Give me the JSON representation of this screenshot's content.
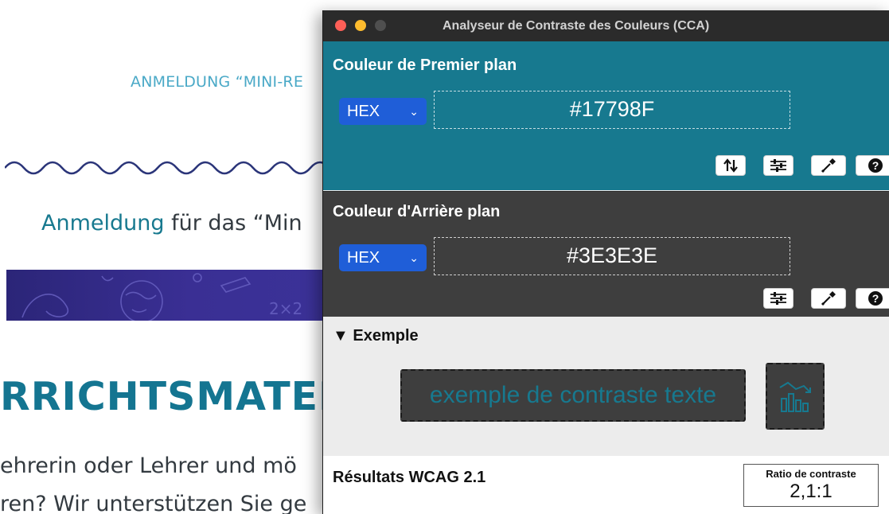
{
  "site": {
    "subtitle": "ANMELDUNG “MINI-RE",
    "lead_link": "Anmeldung",
    "lead_rest": " für das “Min",
    "heading": "RRICHTSMATERIA",
    "para1": "ehrerin oder Lehrer und mö",
    "para2": "ren? Wir unterstützen Sie ge",
    "banner_text": "2×2",
    "colors": {
      "accent": "#17798f",
      "subtitle": "#4aa9c7",
      "banner": "#2b2578"
    }
  },
  "window": {
    "title": "Analyseur de Contraste des Couleurs (CCA)"
  },
  "foreground": {
    "title": "Couleur de Premier plan",
    "format": "HEX",
    "value": "#17798F",
    "tools": [
      "swap-icon",
      "sliders-icon",
      "eyedropper-icon",
      "help-icon"
    ]
  },
  "background": {
    "title": "Couleur d'Arrière plan",
    "format": "HEX",
    "value": "#3E3E3E",
    "tools": [
      "sliders-icon",
      "eyedropper-icon",
      "help-icon"
    ]
  },
  "example": {
    "heading": "▼ Exemple",
    "sample_text": "exemple de contraste texte",
    "chart_button_icon": "chart-icon"
  },
  "results": {
    "title": "Résultats WCAG 2.1",
    "ratio_label": "Ratio de contraste",
    "ratio_value": "2,1:1"
  }
}
